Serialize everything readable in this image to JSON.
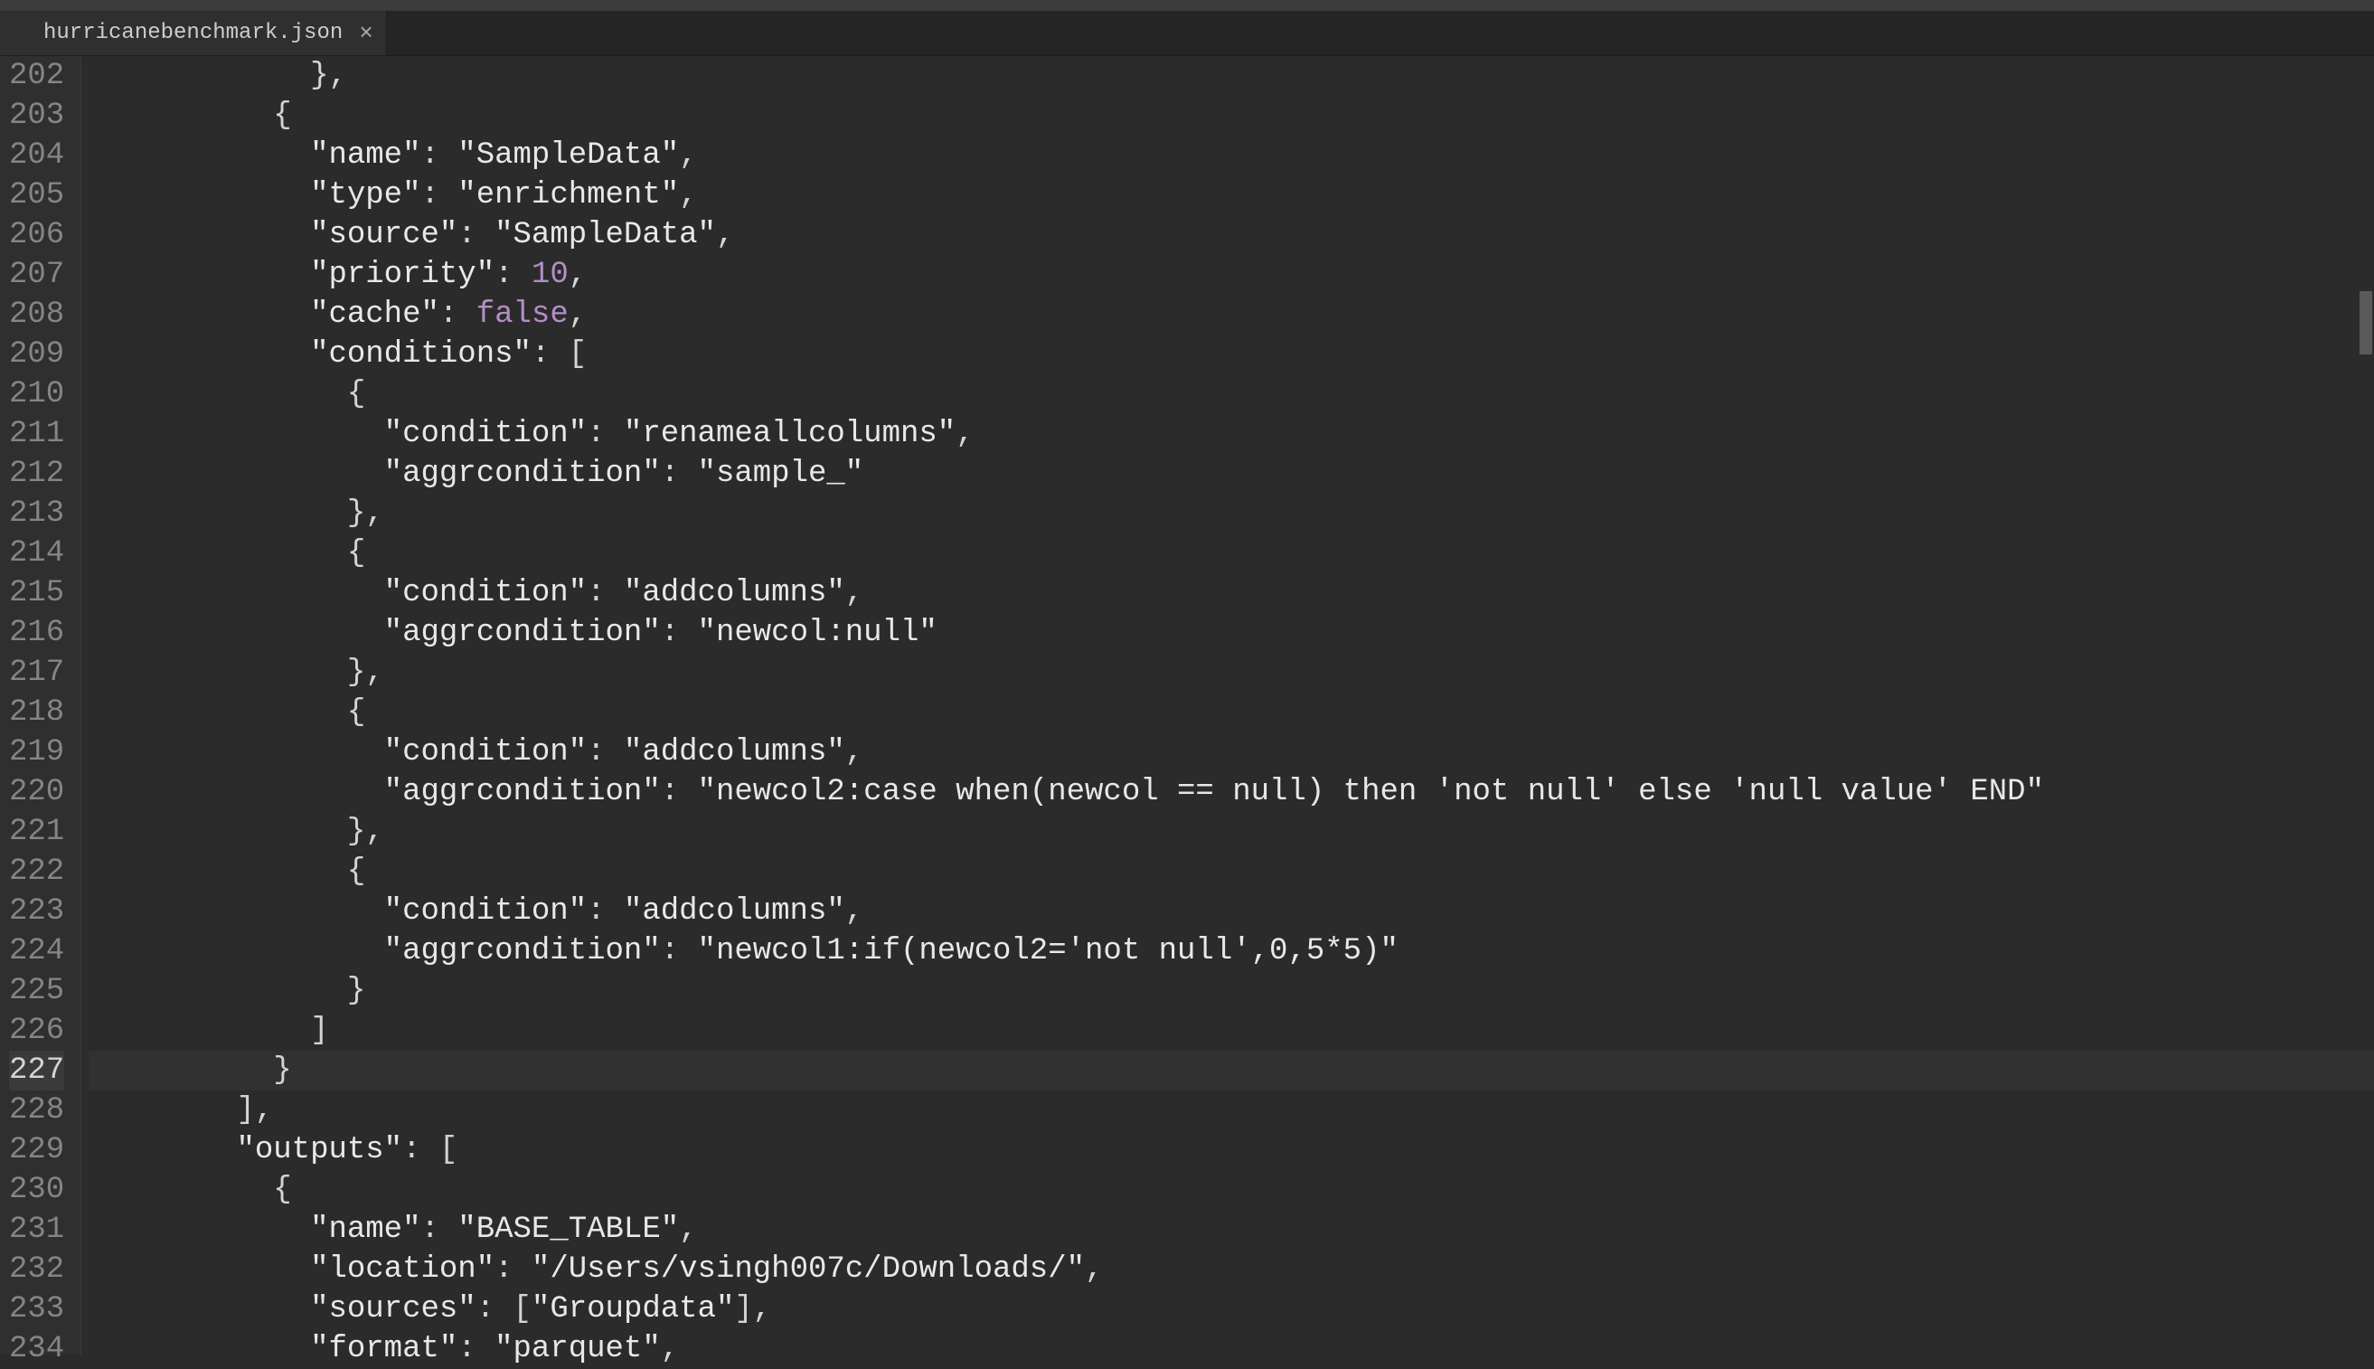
{
  "tab": {
    "filename": "hurricanebenchmark.json"
  },
  "startLine": 202,
  "activeLine": 227,
  "lines": [
    {
      "indent": 12,
      "tokens": [
        {
          "t": "punc",
          "v": "},"
        }
      ]
    },
    {
      "indent": 10,
      "tokens": [
        {
          "t": "punc",
          "v": "{"
        }
      ]
    },
    {
      "indent": 12,
      "tokens": [
        {
          "t": "key",
          "v": "\"name\""
        },
        {
          "t": "punc",
          "v": ": "
        },
        {
          "t": "str",
          "v": "\"SampleData\""
        },
        {
          "t": "punc",
          "v": ","
        }
      ]
    },
    {
      "indent": 12,
      "tokens": [
        {
          "t": "key",
          "v": "\"type\""
        },
        {
          "t": "punc",
          "v": ": "
        },
        {
          "t": "str",
          "v": "\"enrichment\""
        },
        {
          "t": "punc",
          "v": ","
        }
      ]
    },
    {
      "indent": 12,
      "tokens": [
        {
          "t": "key",
          "v": "\"source\""
        },
        {
          "t": "punc",
          "v": ": "
        },
        {
          "t": "str",
          "v": "\"SampleData\""
        },
        {
          "t": "punc",
          "v": ","
        }
      ]
    },
    {
      "indent": 12,
      "tokens": [
        {
          "t": "key",
          "v": "\"priority\""
        },
        {
          "t": "punc",
          "v": ": "
        },
        {
          "t": "num",
          "v": "10"
        },
        {
          "t": "punc",
          "v": ","
        }
      ]
    },
    {
      "indent": 12,
      "tokens": [
        {
          "t": "key",
          "v": "\"cache\""
        },
        {
          "t": "punc",
          "v": ": "
        },
        {
          "t": "bool",
          "v": "false"
        },
        {
          "t": "punc",
          "v": ","
        }
      ]
    },
    {
      "indent": 12,
      "tokens": [
        {
          "t": "key",
          "v": "\"conditions\""
        },
        {
          "t": "punc",
          "v": ": ["
        }
      ]
    },
    {
      "indent": 14,
      "tokens": [
        {
          "t": "punc",
          "v": "{"
        }
      ]
    },
    {
      "indent": 16,
      "tokens": [
        {
          "t": "key",
          "v": "\"condition\""
        },
        {
          "t": "punc",
          "v": ": "
        },
        {
          "t": "str",
          "v": "\"renameallcolumns\""
        },
        {
          "t": "punc",
          "v": ","
        }
      ]
    },
    {
      "indent": 16,
      "tokens": [
        {
          "t": "key",
          "v": "\"aggrcondition\""
        },
        {
          "t": "punc",
          "v": ": "
        },
        {
          "t": "str",
          "v": "\"sample_\""
        }
      ]
    },
    {
      "indent": 14,
      "tokens": [
        {
          "t": "punc",
          "v": "},"
        }
      ]
    },
    {
      "indent": 14,
      "tokens": [
        {
          "t": "punc",
          "v": "{"
        }
      ]
    },
    {
      "indent": 16,
      "tokens": [
        {
          "t": "key",
          "v": "\"condition\""
        },
        {
          "t": "punc",
          "v": ": "
        },
        {
          "t": "str",
          "v": "\"addcolumns\""
        },
        {
          "t": "punc",
          "v": ","
        }
      ]
    },
    {
      "indent": 16,
      "tokens": [
        {
          "t": "key",
          "v": "\"aggrcondition\""
        },
        {
          "t": "punc",
          "v": ": "
        },
        {
          "t": "str",
          "v": "\"newcol:null\""
        }
      ]
    },
    {
      "indent": 14,
      "tokens": [
        {
          "t": "punc",
          "v": "},"
        }
      ]
    },
    {
      "indent": 14,
      "tokens": [
        {
          "t": "punc",
          "v": "{"
        }
      ]
    },
    {
      "indent": 16,
      "tokens": [
        {
          "t": "key",
          "v": "\"condition\""
        },
        {
          "t": "punc",
          "v": ": "
        },
        {
          "t": "str",
          "v": "\"addcolumns\""
        },
        {
          "t": "punc",
          "v": ","
        }
      ]
    },
    {
      "indent": 16,
      "tokens": [
        {
          "t": "key",
          "v": "\"aggrcondition\""
        },
        {
          "t": "punc",
          "v": ": "
        },
        {
          "t": "str",
          "v": "\"newcol2:case when(newcol == null) then 'not null' else 'null value' END\""
        }
      ]
    },
    {
      "indent": 14,
      "tokens": [
        {
          "t": "punc",
          "v": "},"
        }
      ]
    },
    {
      "indent": 14,
      "tokens": [
        {
          "t": "punc",
          "v": "{"
        }
      ]
    },
    {
      "indent": 16,
      "tokens": [
        {
          "t": "key",
          "v": "\"condition\""
        },
        {
          "t": "punc",
          "v": ": "
        },
        {
          "t": "str",
          "v": "\"addcolumns\""
        },
        {
          "t": "punc",
          "v": ","
        }
      ]
    },
    {
      "indent": 16,
      "tokens": [
        {
          "t": "key",
          "v": "\"aggrcondition\""
        },
        {
          "t": "punc",
          "v": ": "
        },
        {
          "t": "str",
          "v": "\"newcol1:if(newcol2='not null',0,5*5)\""
        }
      ]
    },
    {
      "indent": 14,
      "tokens": [
        {
          "t": "punc",
          "v": "}"
        }
      ]
    },
    {
      "indent": 12,
      "tokens": [
        {
          "t": "punc",
          "v": "]"
        }
      ]
    },
    {
      "indent": 10,
      "tokens": [
        {
          "t": "punc",
          "v": "}"
        }
      ]
    },
    {
      "indent": 8,
      "tokens": [
        {
          "t": "punc",
          "v": "],"
        }
      ]
    },
    {
      "indent": 8,
      "tokens": [
        {
          "t": "key",
          "v": "\"outputs\""
        },
        {
          "t": "punc",
          "v": ": ["
        }
      ]
    },
    {
      "indent": 10,
      "tokens": [
        {
          "t": "punc",
          "v": "{"
        }
      ]
    },
    {
      "indent": 12,
      "tokens": [
        {
          "t": "key",
          "v": "\"name\""
        },
        {
          "t": "punc",
          "v": ": "
        },
        {
          "t": "str",
          "v": "\"BASE_TABLE\""
        },
        {
          "t": "punc",
          "v": ","
        }
      ]
    },
    {
      "indent": 12,
      "tokens": [
        {
          "t": "key",
          "v": "\"location\""
        },
        {
          "t": "punc",
          "v": ": "
        },
        {
          "t": "str",
          "v": "\"/Users/vsingh007c/Downloads/\""
        },
        {
          "t": "punc",
          "v": ","
        }
      ]
    },
    {
      "indent": 12,
      "tokens": [
        {
          "t": "key",
          "v": "\"sources\""
        },
        {
          "t": "punc",
          "v": ": ["
        },
        {
          "t": "str",
          "v": "\"Groupdata\""
        },
        {
          "t": "punc",
          "v": "],"
        }
      ]
    },
    {
      "indent": 12,
      "tokens": [
        {
          "t": "key",
          "v": "\"format\""
        },
        {
          "t": "punc",
          "v": ": "
        },
        {
          "t": "str",
          "v": "\"parquet\""
        },
        {
          "t": "punc",
          "v": ","
        }
      ]
    }
  ]
}
